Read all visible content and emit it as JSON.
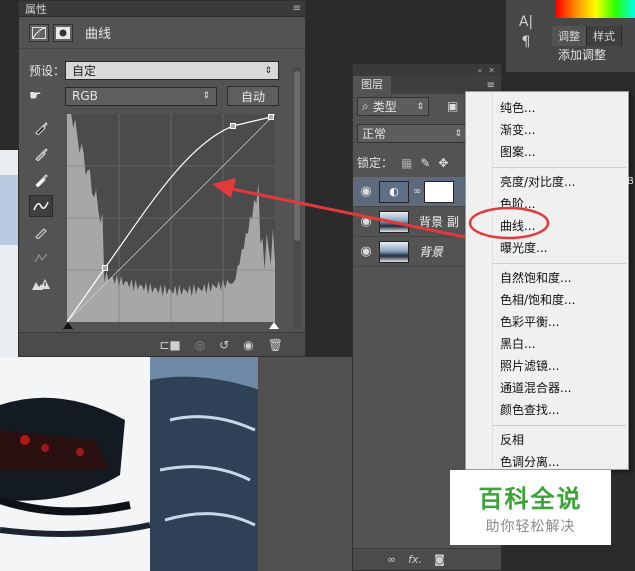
{
  "properties_panel": {
    "title": "属性",
    "panel_name": "曲线",
    "preset_label": "预设：",
    "preset_value": "自定",
    "channel_value": "RGB",
    "auto_button": "自动",
    "icons": [
      "curves-adjustment-icon",
      "layer-mask-icon",
      "hand-adjust-icon",
      "eyedropper-black-icon",
      "eyedropper-gray-icon",
      "eyedropper-white-icon",
      "curve-point-icon",
      "pencil-icon",
      "smooth-icon",
      "clipping-warning-icon",
      "clip-to-layer-icon",
      "view-previous-icon",
      "reset-icon",
      "visibility-icon",
      "trash-icon"
    ]
  },
  "adjust_panel": {
    "tabs": [
      "调整",
      "样式"
    ],
    "title": "添加调整"
  },
  "layers_panel": {
    "tab": "图层",
    "filter_kind": "类型",
    "blend_mode": "正常",
    "lock_label": "锁定：",
    "layers": [
      {
        "name": "",
        "type": "adjustment",
        "selected": true
      },
      {
        "name": "背景 副",
        "type": "photo",
        "selected": false
      },
      {
        "name": "背景",
        "type": "photo",
        "selected": false,
        "italic": true
      }
    ],
    "footer_fx": "fx."
  },
  "context_menu": {
    "groups": [
      [
        "纯色...",
        "渐变...",
        "图案..."
      ],
      [
        "亮度/对比度...",
        "色阶...",
        "曲线...",
        "曝光度..."
      ],
      [
        "自然饱和度...",
        "色相/饱和度...",
        "色彩平衡...",
        "黑白...",
        "照片滤镜...",
        "通道混合器...",
        "颜色查找..."
      ],
      [
        "反相",
        "色调分离..."
      ]
    ],
    "highlighted": "曲线..."
  },
  "watermark": {
    "title": "百科全说",
    "subtitle": "助你轻松解决"
  },
  "colors": {
    "annotation_red": "#e23a3a",
    "watermark_green": "#38a534",
    "panel_bg": "#535353"
  }
}
